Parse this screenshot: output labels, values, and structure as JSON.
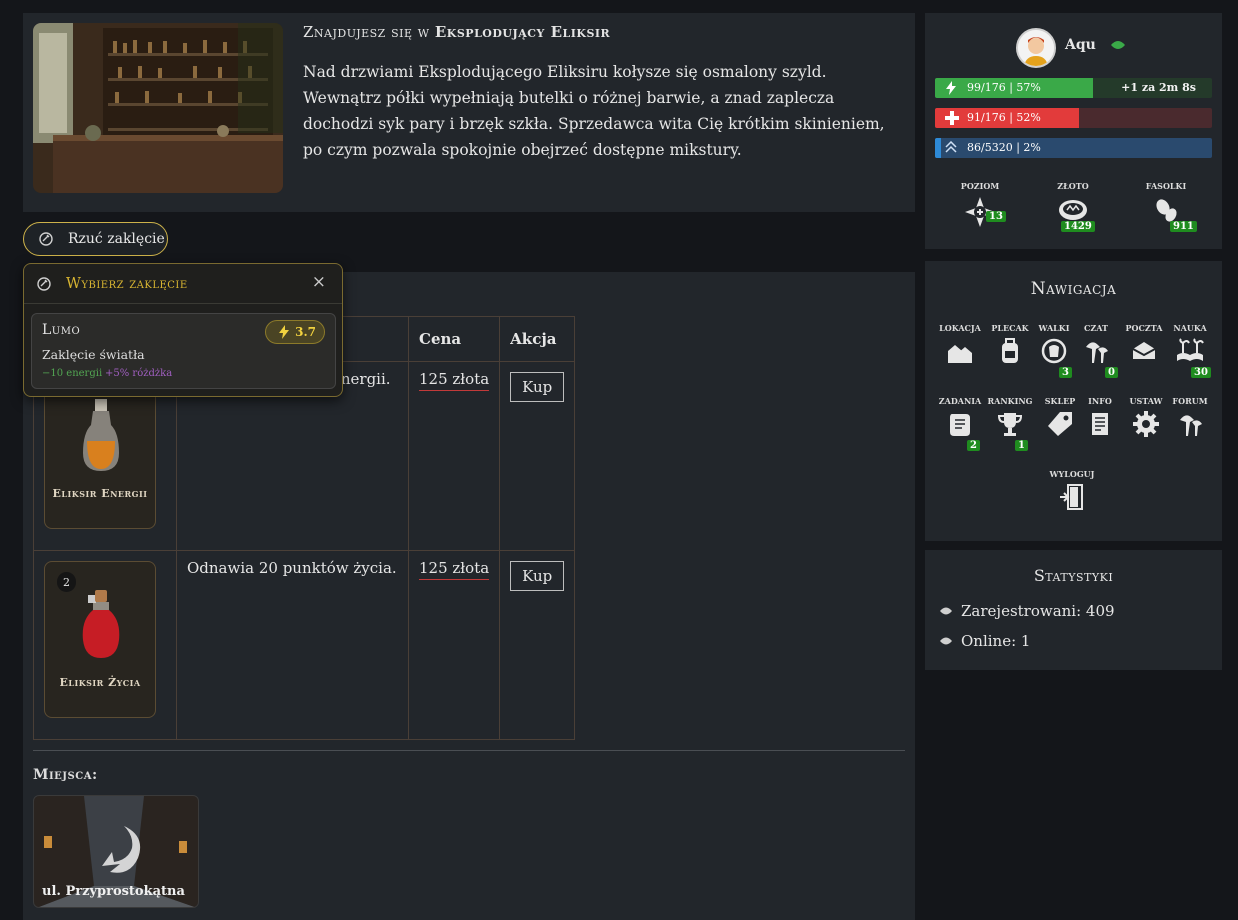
{
  "location": {
    "title_prefix": "Znajdujesz się w",
    "title_name": "Eksplodujący Eliksir",
    "description": "Nad drzwiami Eksplodującego Eliksiru kołysze się osmalony szyld. Wewnątrz półki wypełniają butelki o różnej barwie, a znad zaplecza dochodzi syk pary i brzęk szkła. Sprzedawca wita Cię krótkim skinieniem, po czym pozwala spokojnie obejrzeć dostępne mikstury."
  },
  "spell_button": {
    "label": "Rzuć zaklęcie"
  },
  "spell_popup": {
    "title": "Wybierz zaklęcie",
    "close": "×",
    "spell": {
      "name": "Lumo",
      "cost": "3.7",
      "description": "Zaklęcie światła",
      "effect_energy": "−10 energii",
      "effect_wand": "+5% różdżka"
    }
  },
  "shop": {
    "headers": {
      "price": "Cena",
      "action": "Akcja"
    },
    "rows": [
      {
        "item_name": "Eliksir Energii",
        "description_visible": "energii.",
        "price": "125 złota",
        "buy": "Kup"
      },
      {
        "item_name": "Eliksir Życia",
        "badge_count": "2",
        "description": "Odnawia 20 punktów życia.",
        "price": "125 złota",
        "buy": "Kup"
      }
    ]
  },
  "places": {
    "title": "Miejsca:",
    "items": [
      {
        "name": "ul. Przyprostokątna"
      }
    ]
  },
  "profile": {
    "username": "Aqu",
    "energy": {
      "text": "99/176 | 57%",
      "extra": "+1 za 2m 8s",
      "fill": 0.57,
      "color": "#3aa948"
    },
    "health": {
      "text": "91/176 | 52%",
      "fill": 0.52,
      "color": "#e23b3b"
    },
    "xp": {
      "text": "86/5320 | 2%",
      "fill": 0.02,
      "color": "#2e8ad6"
    },
    "stats": [
      {
        "label": "POZIOM",
        "value": "13",
        "icon": "level-icon"
      },
      {
        "label": "ZŁOTO",
        "value": "1429",
        "icon": "gold-coin-icon"
      },
      {
        "label": "FASOLKI",
        "value": "911",
        "icon": "beans-icon"
      }
    ]
  },
  "navigation": {
    "title": "Nawigacja",
    "items": [
      {
        "label": "LOKACJA",
        "icon": "houses-icon"
      },
      {
        "label": "PLECAK",
        "icon": "backpack-icon"
      },
      {
        "label": "WALKI",
        "icon": "fist-icon",
        "badge": "3"
      },
      {
        "label": "CZAT",
        "icon": "chat-icon",
        "badge": "0"
      },
      {
        "label": "POCZTA",
        "icon": "mail-icon"
      },
      {
        "label": "NAUKA",
        "icon": "book-icon",
        "badge": "30"
      },
      {
        "label": "ZADANIA",
        "icon": "scroll-icon",
        "badge": "2"
      },
      {
        "label": "RANKING",
        "icon": "trophy-icon",
        "badge": "1"
      },
      {
        "label": "SKLEP",
        "icon": "tag-icon"
      },
      {
        "label": "INFO",
        "icon": "document-icon"
      },
      {
        "label": "USTAW",
        "icon": "gear-icon"
      },
      {
        "label": "FORUM",
        "icon": "forum-icon"
      },
      {
        "label": "WYLOGUJ",
        "icon": "logout-icon"
      }
    ]
  },
  "statistics": {
    "title": "Statystyki",
    "registered": "Zarejestrowani: 409",
    "online": "Online: 1"
  }
}
